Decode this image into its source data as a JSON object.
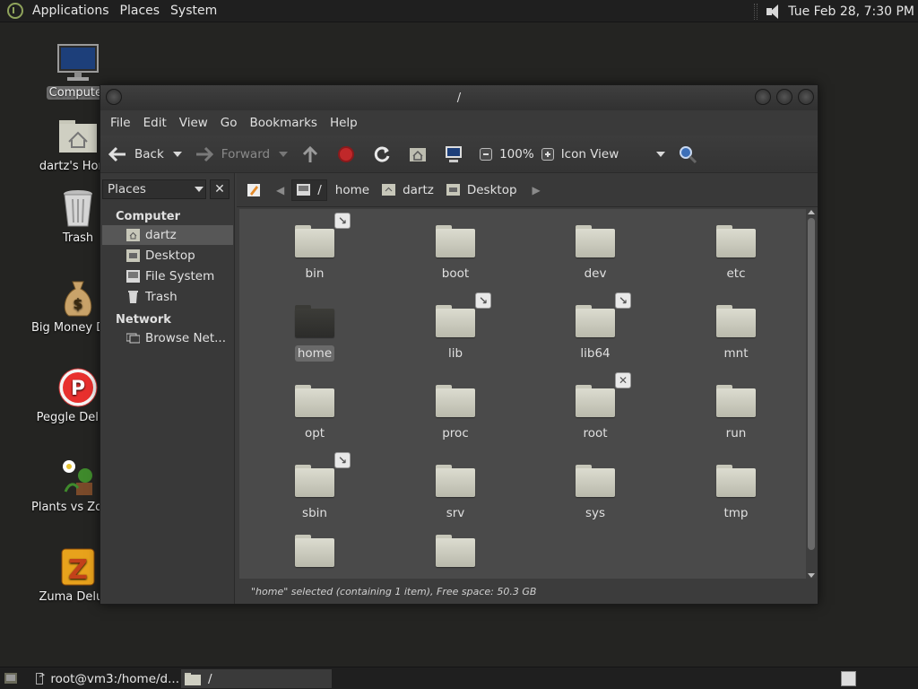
{
  "top_panel": {
    "menus": [
      "Applications",
      "Places",
      "System"
    ],
    "clock": "Tue Feb 28,  7:30 PM"
  },
  "desktop_icons": [
    {
      "label": "Computer",
      "icon": "computer-icon"
    },
    {
      "label": "dartz's Home",
      "icon": "home-folder-icon"
    },
    {
      "label": "Trash",
      "icon": "trash-icon"
    },
    {
      "label": "Big Money Deluxe",
      "icon": "money-bag-icon"
    },
    {
      "label": "Peggle Deluxe",
      "icon": "peggle-icon"
    },
    {
      "label": "Plants vs Zombies",
      "icon": "plants-icon"
    },
    {
      "label": "Zuma Deluxe",
      "icon": "zuma-icon"
    }
  ],
  "window": {
    "title": "/",
    "menus": [
      "File",
      "Edit",
      "View",
      "Go",
      "Bookmarks",
      "Help"
    ],
    "toolbar": {
      "back": "Back",
      "forward": "Forward",
      "zoom": "100%",
      "view_mode": "Icon View"
    },
    "sidebar": {
      "combo": "Places",
      "sections": [
        {
          "title": "Computer",
          "items": [
            "dartz",
            "Desktop",
            "File System",
            "Trash"
          ]
        },
        {
          "title": "Network",
          "items": [
            "Browse Net..."
          ]
        }
      ]
    },
    "path": [
      "/",
      "home",
      "dartz",
      "Desktop"
    ],
    "folders": [
      {
        "name": "bin",
        "emblem": "symlink"
      },
      {
        "name": "boot",
        "emblem": ""
      },
      {
        "name": "dev",
        "emblem": ""
      },
      {
        "name": "etc",
        "emblem": ""
      },
      {
        "name": "home",
        "emblem": "",
        "selected": true
      },
      {
        "name": "lib",
        "emblem": "symlink"
      },
      {
        "name": "lib64",
        "emblem": "symlink"
      },
      {
        "name": "mnt",
        "emblem": ""
      },
      {
        "name": "opt",
        "emblem": ""
      },
      {
        "name": "proc",
        "emblem": ""
      },
      {
        "name": "root",
        "emblem": "no-access"
      },
      {
        "name": "run",
        "emblem": ""
      },
      {
        "name": "sbin",
        "emblem": "symlink"
      },
      {
        "name": "srv",
        "emblem": ""
      },
      {
        "name": "sys",
        "emblem": ""
      },
      {
        "name": "tmp",
        "emblem": ""
      },
      {
        "name": "",
        "emblem": ""
      },
      {
        "name": "",
        "emblem": ""
      }
    ],
    "status": "\"home\" selected (containing 1 item), Free space: 50.3 GB"
  },
  "taskbar": {
    "tasks": [
      "root@vm3:/home/d...",
      "/"
    ]
  },
  "colors": {
    "desktop_bg": "#242422",
    "panel_bg": "#1f1f1f",
    "window_bg": "#3c3c3c",
    "iconview_bg": "#4a4a4a",
    "folder": "#cfcfc2",
    "stop_red": "#c0282a"
  }
}
